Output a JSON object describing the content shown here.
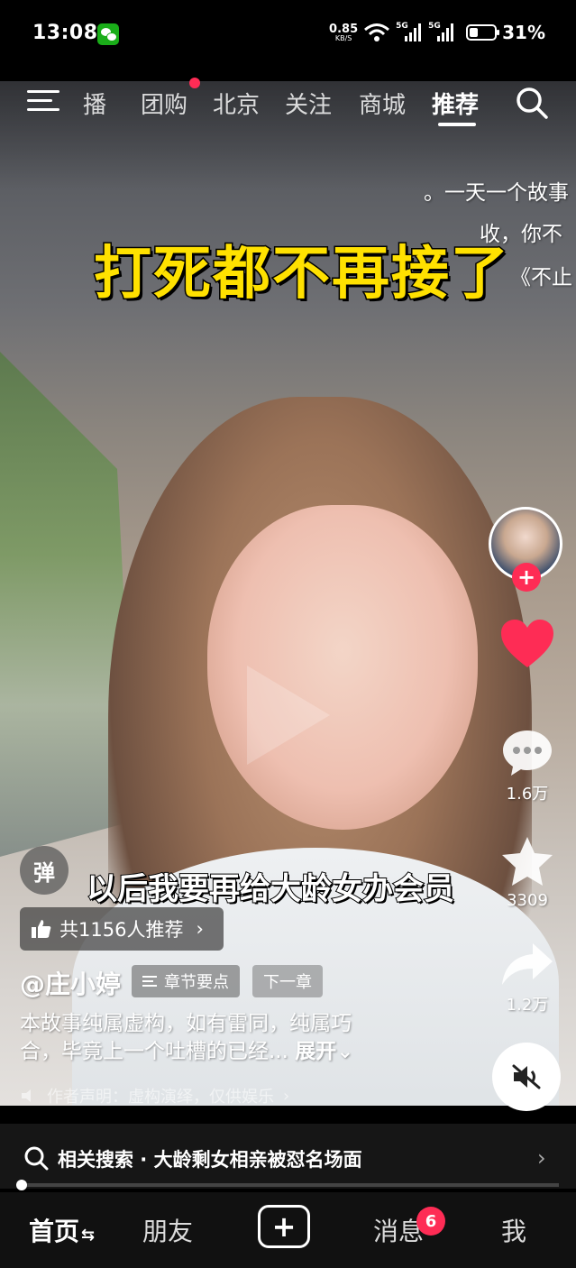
{
  "status_bar": {
    "time": "13:08",
    "net_speed_value": "0.85",
    "net_speed_unit": "KB/S",
    "sim1_tag": "5G",
    "sim2_tag": "5G",
    "battery_percent": "31%",
    "battery_level": 0.31
  },
  "top_nav": {
    "tabs": [
      "直播",
      "团购",
      "北京",
      "关注",
      "商城",
      "推荐"
    ],
    "tab_live_visible": "播",
    "active_tab": "推荐"
  },
  "video": {
    "title_caption": "打死都不再接了",
    "story_lines": [
      "。一天一个故事",
      "收，你不",
      "《不止"
    ],
    "subtitle": "以后我要再给大龄女办会员"
  },
  "left_panel": {
    "danmaku_label": "弹",
    "recommend_text": "共1156人推荐",
    "author": "@庄小婷",
    "chapter_label": "章节要点",
    "next_label": "下一章",
    "description_line1": "本故事纯属虚构，如有雷同，纯属巧",
    "description_line2": "合，毕竟上一个吐槽的已经... ",
    "expand_label": "展开",
    "disclaimer": "作者声明：虚构演绎，仅供娱乐"
  },
  "right_rail": {
    "comment_count": "1.6万",
    "favorite_count": "3309",
    "share_count": "1.2万"
  },
  "related_search": {
    "label": "相关搜索 · 大龄剩女相亲被怼名场面"
  },
  "bottom_nav": {
    "home": "首页",
    "friends": "朋友",
    "messages": "消息",
    "message_badge": "6",
    "me": "我"
  },
  "colors": {
    "accent_red": "#fe2c55",
    "caption_yellow": "#ffe100"
  }
}
